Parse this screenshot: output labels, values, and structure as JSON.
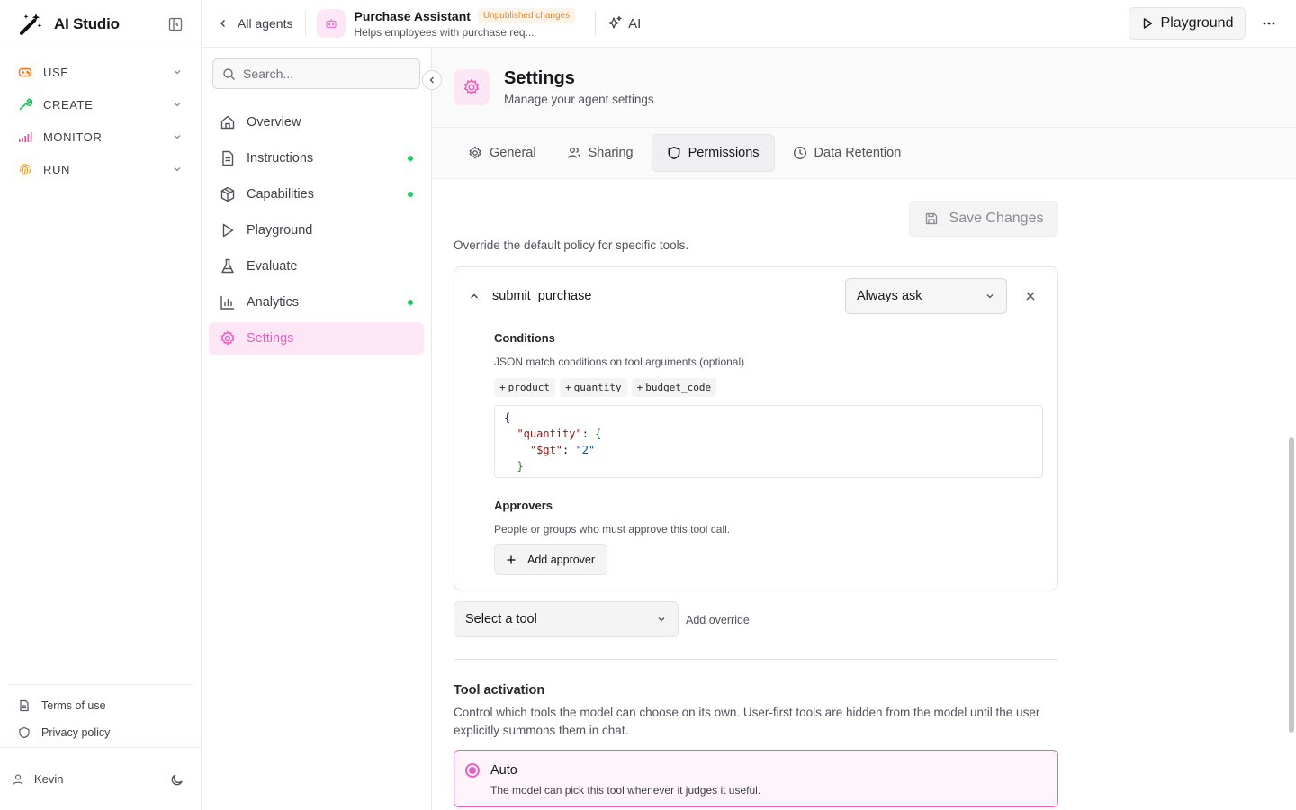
{
  "app": {
    "name": "AI Studio"
  },
  "sidebar": {
    "groups": [
      {
        "label": "USE",
        "icon": "gamepad-icon",
        "color": "#f97316"
      },
      {
        "label": "CREATE",
        "icon": "wrench-icon",
        "color": "#22c55e"
      },
      {
        "label": "MONITOR",
        "icon": "signal-icon",
        "color": "#ec4899"
      },
      {
        "label": "RUN",
        "icon": "fingerprint-icon",
        "color": "#f59e0b"
      }
    ],
    "footer_links": [
      {
        "label": "Terms of use",
        "icon": "document-icon"
      },
      {
        "label": "Privacy policy",
        "icon": "shield-icon"
      }
    ],
    "user": {
      "name": "Kevin"
    }
  },
  "topbar": {
    "back_label": "All agents",
    "agent_name": "Purchase Assistant",
    "badge": "Unpublished changes",
    "agent_desc": "Helps employees with purchase req...",
    "ai_label": "AI",
    "playground_label": "Playground"
  },
  "subnav": {
    "search_placeholder": "Search...",
    "items": [
      {
        "label": "Overview",
        "icon": "home-icon",
        "dot": false
      },
      {
        "label": "Instructions",
        "icon": "file-text-icon",
        "dot": true
      },
      {
        "label": "Capabilities",
        "icon": "cube-icon",
        "dot": true
      },
      {
        "label": "Playground",
        "icon": "play-icon",
        "dot": false
      },
      {
        "label": "Evaluate",
        "icon": "flask-icon",
        "dot": false
      },
      {
        "label": "Analytics",
        "icon": "bar-chart-icon",
        "dot": true
      },
      {
        "label": "Settings",
        "icon": "gear-icon",
        "dot": false,
        "active": true
      }
    ]
  },
  "page": {
    "title": "Settings",
    "subtitle": "Manage your agent settings",
    "tabs": [
      {
        "label": "General",
        "icon": "gear-icon"
      },
      {
        "label": "Sharing",
        "icon": "users-icon"
      },
      {
        "label": "Permissions",
        "icon": "shield-icon",
        "active": true
      },
      {
        "label": "Data Retention",
        "icon": "clock-icon"
      }
    ],
    "save_label": "Save Changes",
    "override_note": "Override the default policy for specific tools.",
    "tool_override": {
      "tool_name": "submit_purchase",
      "policy": "Always ask",
      "conditions_title": "Conditions",
      "conditions_desc": "JSON match conditions on tool arguments (optional)",
      "chips": [
        "product",
        "quantity",
        "budget_code"
      ],
      "code": {
        "line1": "{",
        "key": "\"quantity\"",
        "nested_key": "\"$gt\"",
        "nested_val": "\"2\"",
        "close_inner": "}"
      },
      "approvers_title": "Approvers",
      "approvers_desc": "People or groups who must approve this tool call.",
      "add_approver_label": "Add approver"
    },
    "tool_select_placeholder": "Select a tool",
    "add_override_label": "Add override",
    "activation": {
      "title": "Tool activation",
      "desc": "Control which tools the model can choose on its own. User-first tools are hidden from the model until the user explicitly summons them in chat.",
      "option_title": "Auto",
      "option_desc": "The model can pick this tool whenever it judges it useful."
    }
  },
  "colors": {
    "accent": "#e85fc1",
    "accent_bg": "#fde7f6",
    "dot": "#22c55e",
    "badge_text": "#e08a2e"
  }
}
